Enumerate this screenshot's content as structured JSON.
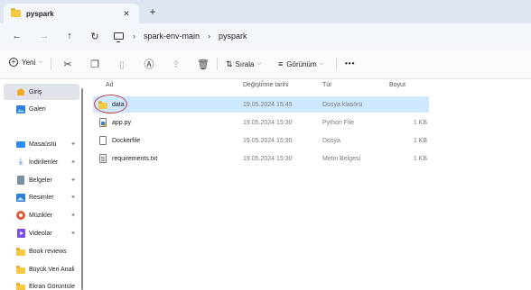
{
  "window": {
    "tab_title": "pyspark",
    "tab_close": "✕",
    "new_tab": "+"
  },
  "nav": {
    "back": "←",
    "forward": "→",
    "up": "↑",
    "refresh": "↻"
  },
  "address": {
    "crumbs": [
      "spark-env-main",
      "pyspark"
    ],
    "separator": "›"
  },
  "toolbar": {
    "new_label": "Yeni",
    "sort_label": "Sırala",
    "view_label": "Görünüm",
    "more": "•••"
  },
  "sidebar": {
    "items": [
      {
        "label": "Giriş",
        "icon": "home-icon"
      },
      {
        "label": "Galeri",
        "icon": "gallery-icon"
      },
      {
        "label": "Masaüstü",
        "icon": "desktop-icon",
        "pinned": true
      },
      {
        "label": "İndirilenler",
        "icon": "download-icon",
        "pinned": true
      },
      {
        "label": "Belgeler",
        "icon": "documents-icon",
        "pinned": true
      },
      {
        "label": "Resimler",
        "icon": "pictures-icon",
        "pinned": true
      },
      {
        "label": "Müzikler",
        "icon": "music-icon",
        "pinned": true
      },
      {
        "label": "Videolar",
        "icon": "videos-icon",
        "pinned": true
      },
      {
        "label": "Book reviews",
        "icon": "folder-icon"
      },
      {
        "label": "Büyük Veri Anali",
        "icon": "folder-icon"
      },
      {
        "label": "Ekran Görüntüle",
        "icon": "folder-icon"
      }
    ],
    "pin_glyph": "✦"
  },
  "list": {
    "columns": [
      "Ad",
      "Değiştirme tarihi",
      "Tür",
      "Boyut"
    ],
    "rows": [
      {
        "name": "data",
        "modified": "19.05.2024 15:45",
        "type": "Dosya klasörü",
        "size": "",
        "icon": "folder-icon",
        "selected": true
      },
      {
        "name": "app.py",
        "modified": "19.05.2024 15:30",
        "type": "Python File",
        "size": "1 KB",
        "icon": "python-file-icon"
      },
      {
        "name": "Dockerfile",
        "modified": "19.05.2024 15:30",
        "type": "Dosya",
        "size": "1 KB",
        "icon": "file-icon"
      },
      {
        "name": "requirements.txt",
        "modified": "19.05.2024 15:30",
        "type": "Metin Belgesi",
        "size": "1 KB",
        "icon": "text-file-icon"
      }
    ]
  },
  "colors": {
    "selection": "#cde8ff",
    "annotation_circle": "#c23b4a",
    "tab_bar": "#dfe6f1"
  }
}
